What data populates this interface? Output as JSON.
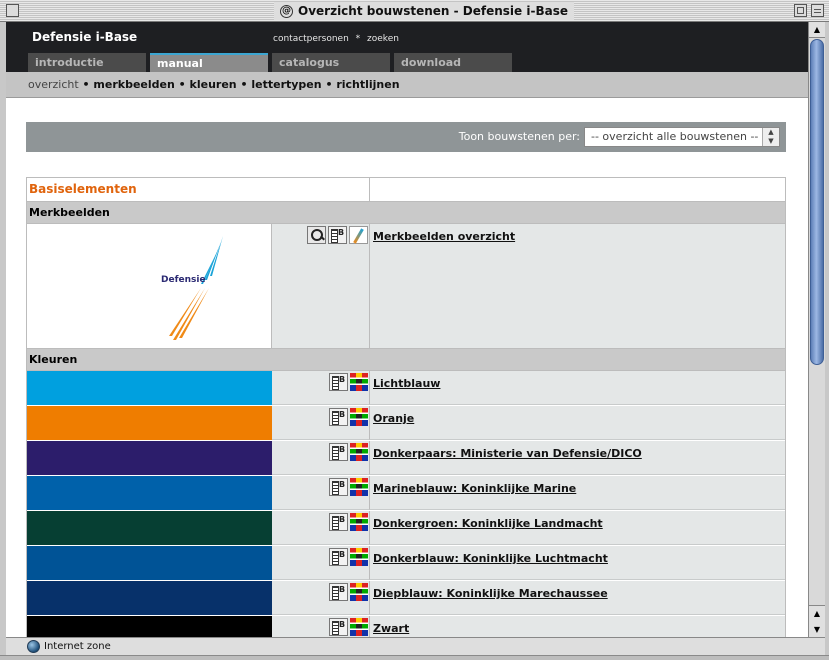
{
  "window": {
    "title": "Overzicht bouwstenen - Defensie i-Base",
    "status": "Internet zone"
  },
  "site": {
    "logo": "Defensie i-Base",
    "toplinks": [
      "contactpersonen",
      "zoeken"
    ],
    "toplink_separator": "*",
    "tabs": [
      {
        "label": "introductie",
        "active": false
      },
      {
        "label": "manual",
        "active": true
      },
      {
        "label": "catalogus",
        "active": false
      },
      {
        "label": "download",
        "active": false
      }
    ],
    "subnav": {
      "current": "overzicht",
      "items": [
        "merkbeelden",
        "kleuren",
        "lettertypen",
        "richtlijnen"
      ],
      "separator": "•"
    }
  },
  "filter": {
    "label": "Toon bouwstenen per:",
    "selected": "-- overzicht alle bouwstenen --"
  },
  "table": {
    "section": "Basiselementen",
    "groups": {
      "merkbeelden": {
        "title": "Merkbeelden",
        "item_label": "Merkbeelden overzicht",
        "logo_text": "Defensie"
      },
      "kleuren": {
        "title": "Kleuren",
        "items": [
          {
            "label": "Lichtblauw",
            "color": "#00a0df"
          },
          {
            "label": "Oranje",
            "color": "#ef7d00"
          },
          {
            "label": "Donkerpaars: Ministerie van Defensie/DICO",
            "color": "#2c1d6b"
          },
          {
            "label": "Marineblauw: Koninklijke Marine",
            "color": "#0061aa"
          },
          {
            "label": "Donkergroen: Koninklijke Landmacht",
            "color": "#063f33"
          },
          {
            "label": "Donkerblauw: Koninklijke Luchtmacht",
            "color": "#005396"
          },
          {
            "label": "Diepblauw: Koninklijke Marechaussee",
            "color": "#07316a"
          },
          {
            "label": "Zwart",
            "color": "#000000"
          }
        ]
      }
    }
  },
  "colors": {
    "accent_tab": "#3ca6d2",
    "section_title": "#e0640d",
    "header_bg": "#1e1f22"
  }
}
